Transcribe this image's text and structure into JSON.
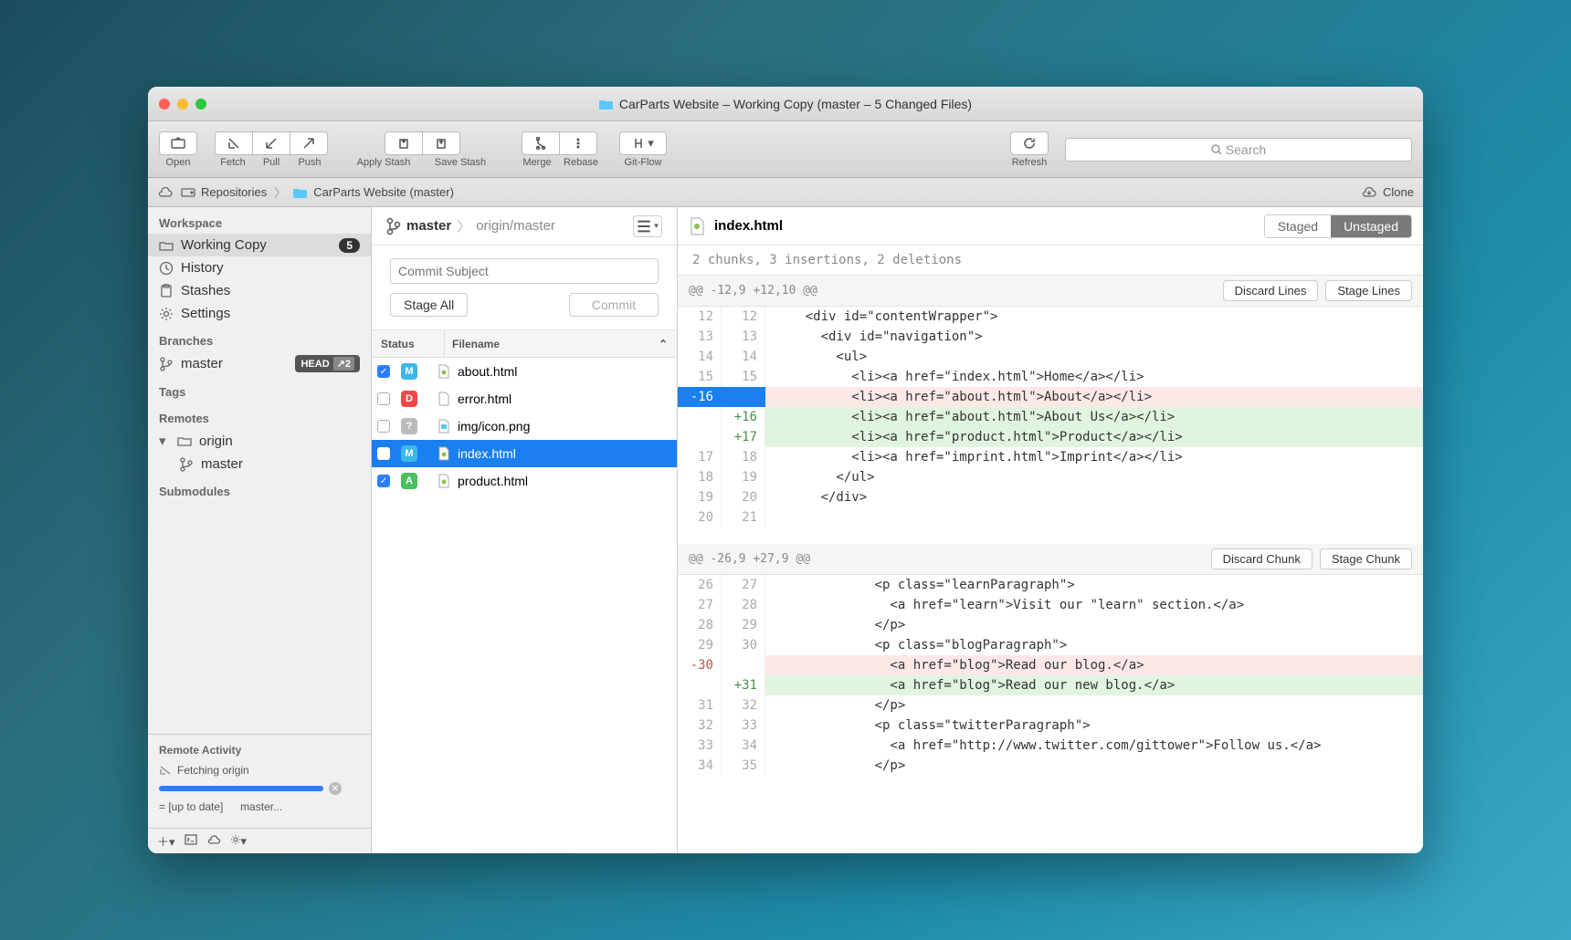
{
  "window": {
    "title": "CarParts Website – Working Copy (master – 5 Changed Files)"
  },
  "toolbar": {
    "open": "Open",
    "fetch": "Fetch",
    "pull": "Pull",
    "push": "Push",
    "apply_stash": "Apply Stash",
    "save_stash": "Save Stash",
    "merge": "Merge",
    "rebase": "Rebase",
    "gitflow": "Git-Flow",
    "refresh": "Refresh",
    "search_placeholder": "Search"
  },
  "pathbar": {
    "repositories": "Repositories",
    "current": "CarParts Website (master)",
    "clone": "Clone"
  },
  "sidebar": {
    "workspace_label": "Workspace",
    "working_copy": "Working Copy",
    "working_copy_badge": "5",
    "history": "History",
    "stashes": "Stashes",
    "settings": "Settings",
    "branches_label": "Branches",
    "master": "master",
    "head_badge": "HEAD",
    "ahead_behind": "↗2",
    "tags_label": "Tags",
    "remotes_label": "Remotes",
    "origin": "origin",
    "origin_master": "master",
    "submodules_label": "Submodules",
    "activity_label": "Remote Activity",
    "activity_status": "Fetching origin",
    "activity_line1": "= [up to date]",
    "activity_line2": "master..."
  },
  "branchrow": {
    "local": "master",
    "remote": "origin/master"
  },
  "commit": {
    "subject_placeholder": "Commit Subject",
    "stage_all": "Stage All",
    "commit": "Commit"
  },
  "filelist": {
    "status_header": "Status",
    "filename_header": "Filename",
    "files": [
      {
        "checked": true,
        "status": "M",
        "name": "about.html",
        "type": "html"
      },
      {
        "checked": false,
        "status": "D",
        "name": "error.html",
        "type": "file"
      },
      {
        "checked": false,
        "status": "?",
        "name": "img/icon.png",
        "type": "img"
      },
      {
        "checked": false,
        "status": "M",
        "name": "index.html",
        "type": "html",
        "selected": true
      },
      {
        "checked": true,
        "status": "A",
        "name": "product.html",
        "type": "html"
      }
    ]
  },
  "diff": {
    "filename": "index.html",
    "staged": "Staged",
    "unstaged": "Unstaged",
    "summary": "2 chunks, 3 insertions, 2 deletions",
    "discard_lines": "Discard Lines",
    "stage_lines": "Stage Lines",
    "discard_chunk": "Discard Chunk",
    "stage_chunk": "Stage Chunk",
    "hunks": [
      {
        "header": "@@ -12,9 +12,10 @@",
        "lines": [
          {
            "old": "12",
            "new": "12",
            "t": "ctx",
            "c": "    <div id=\"contentWrapper\">"
          },
          {
            "old": "13",
            "new": "13",
            "t": "ctx",
            "c": "      <div id=\"navigation\">"
          },
          {
            "old": "14",
            "new": "14",
            "t": "ctx",
            "c": "        <ul>"
          },
          {
            "old": "15",
            "new": "15",
            "t": "ctx",
            "c": "          <li><a href=\"index.html\">Home</a></li>"
          },
          {
            "old": "-16",
            "new": "",
            "t": "del",
            "c": "          <li><a href=\"about.html\">About</a></li>"
          },
          {
            "old": "",
            "new": "+16",
            "t": "add",
            "c": "          <li><a href=\"about.html\">About Us</a></li>"
          },
          {
            "old": "",
            "new": "+17",
            "t": "add",
            "c": "          <li><a href=\"product.html\">Product</a></li>"
          },
          {
            "old": "17",
            "new": "18",
            "t": "ctx",
            "c": "          <li><a href=\"imprint.html\">Imprint</a></li>"
          },
          {
            "old": "18",
            "new": "19",
            "t": "ctx",
            "c": "        </ul>"
          },
          {
            "old": "19",
            "new": "20",
            "t": "ctx",
            "c": "      </div>"
          },
          {
            "old": "20",
            "new": "21",
            "t": "ctx",
            "c": ""
          }
        ]
      },
      {
        "header": "@@ -26,9 +27,9 @@",
        "lines": [
          {
            "old": "26",
            "new": "27",
            "t": "ctx",
            "c": "             <p class=\"learnParagraph\">"
          },
          {
            "old": "27",
            "new": "28",
            "t": "ctx",
            "c": "               <a href=\"learn\">Visit our \"learn\" section.</a>"
          },
          {
            "old": "28",
            "new": "29",
            "t": "ctx",
            "c": "             </p>"
          },
          {
            "old": "29",
            "new": "30",
            "t": "ctx",
            "c": "             <p class=\"blogParagraph\">"
          },
          {
            "old": "-30",
            "new": "",
            "t": "del2",
            "c": "               <a href=\"blog\">Read our blog.</a>"
          },
          {
            "old": "",
            "new": "+31",
            "t": "add",
            "c": "               <a href=\"blog\">Read our new blog.</a>"
          },
          {
            "old": "31",
            "new": "32",
            "t": "ctx",
            "c": "             </p>"
          },
          {
            "old": "32",
            "new": "33",
            "t": "ctx",
            "c": "             <p class=\"twitterParagraph\">"
          },
          {
            "old": "33",
            "new": "34",
            "t": "ctx",
            "c": "               <a href=\"http://www.twitter.com/gittower\">Follow us.</a>"
          },
          {
            "old": "34",
            "new": "35",
            "t": "ctx",
            "c": "             </p>"
          }
        ]
      }
    ]
  }
}
